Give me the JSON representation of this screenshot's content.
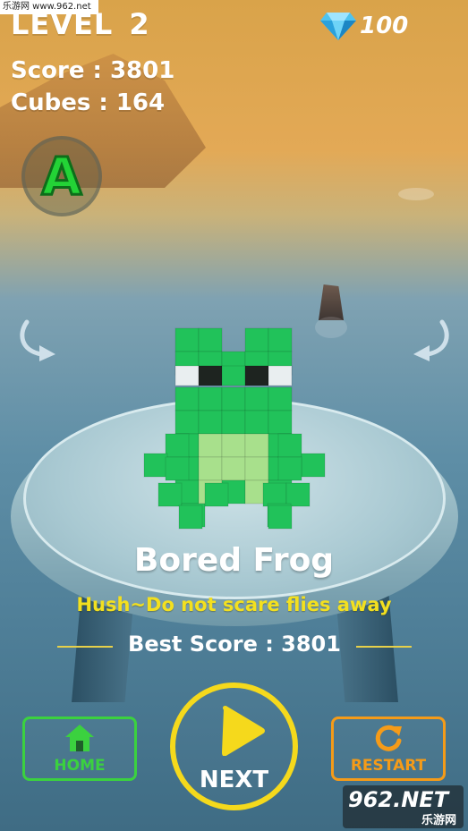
{
  "hud": {
    "level": "LEVEL  2",
    "score": "Score : 3801",
    "cubes": "Cubes : 164",
    "gems": "100",
    "grade": "A"
  },
  "model": {
    "name": "Bored Frog",
    "description": "Hush~Do not scare flies away",
    "best_score": "Best Score : 3801"
  },
  "buttons": {
    "home": "HOME",
    "next": "NEXT",
    "restart": "RESTART"
  },
  "watermark": {
    "site": "乐游网 www.962.net",
    "logo_main": "962.NET",
    "logo_sub": "乐游网"
  },
  "colors": {
    "home": "#3bd13f",
    "restart": "#f59b18",
    "next": "#f5d91c",
    "grade": "#23d336",
    "desc": "#f3e01f",
    "frog_green": "#21c25a",
    "frog_light": "#a8e08c"
  }
}
